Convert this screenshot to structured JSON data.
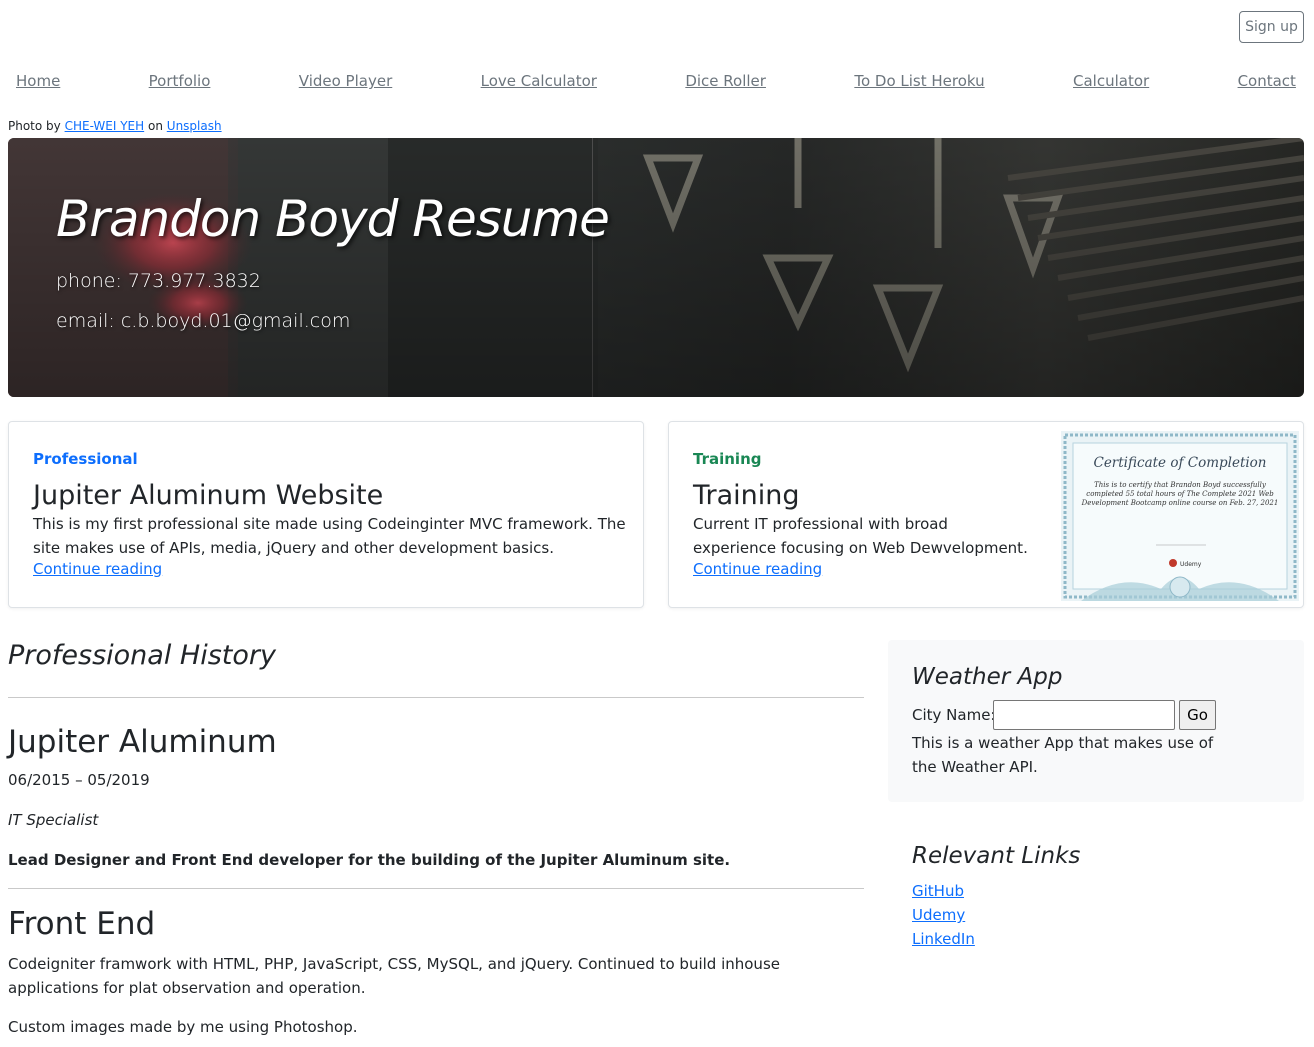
{
  "header": {
    "signup_label": "Sign up"
  },
  "nav": {
    "items": [
      {
        "label": "Home"
      },
      {
        "label": "Portfolio"
      },
      {
        "label": "Video Player"
      },
      {
        "label": "Love Calculator"
      },
      {
        "label": "Dice Roller"
      },
      {
        "label": "To Do List Heroku"
      },
      {
        "label": "Calculator"
      },
      {
        "label": "Contact"
      }
    ]
  },
  "credit": {
    "prefix": "Photo by",
    "author": "CHE-WEI YEH",
    "middle": "on",
    "site": "Unsplash"
  },
  "hero": {
    "title": "Brandon Boyd Resume",
    "phone": "phone: 773.977.3832",
    "email": "email: c.b.boyd.01@gmail.com"
  },
  "cards": [
    {
      "category": "Professional",
      "category_color": "#0d6efd",
      "title": "Jupiter Aluminum Website",
      "text": "This is my first professional site made using Codeinginter MVC framework. The site makes use of APIs, media, jQuery and other development basics.",
      "link": "Continue reading"
    },
    {
      "category": "Training",
      "category_color": "#198754",
      "title": "Training",
      "text": "Current IT professional with broad experience focusing on Web Dewvelopment.",
      "link": "Continue reading",
      "certificate": {
        "heading": "Certificate of Completion",
        "body": "This is to certify that Brandon Boyd successfully completed 55 total hours of The Complete 2021 Web Development Bootcamp online course on Feb. 27, 2021",
        "brand": "Udemy"
      }
    }
  ],
  "history": {
    "title": "Professional History",
    "job": {
      "company": "Jupiter Aluminum",
      "dates": "06/2015 – 05/2019",
      "role": "IT Specialist",
      "lead": "Lead Designer and Front End developer for the building of the Jupiter Aluminum site."
    },
    "front_end": {
      "title": "Front End",
      "desc": "Codeigniter framwork with HTML, PHP, JavaScript, CSS, MySQL, and jQuery. Continued to build inhouse applications for plat observation and operation.",
      "extra": "Custom images made by me using Photoshop."
    }
  },
  "weather": {
    "title": "Weather App",
    "city_label": "City Name:",
    "city_value": "",
    "go_label": "Go",
    "desc": "This is a weather App that makes use of the Weather API."
  },
  "links": {
    "title": "Relevant Links",
    "items": [
      {
        "label": "GitHub"
      },
      {
        "label": "Udemy"
      },
      {
        "label": "LinkedIn"
      }
    ]
  }
}
